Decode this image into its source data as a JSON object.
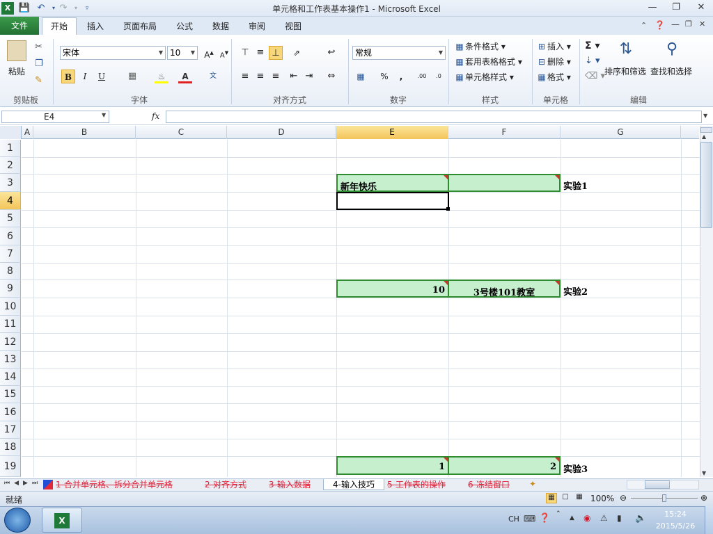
{
  "window": {
    "title": "单元格和工作表基本操作1 - Microsoft Excel"
  },
  "ribbon": {
    "tabs": [
      "文件",
      "开始",
      "插入",
      "页面布局",
      "公式",
      "数据",
      "审阅",
      "视图"
    ],
    "groups": {
      "clipboard": {
        "label": "剪贴板",
        "paste": "粘贴"
      },
      "font": {
        "label": "字体",
        "name": "宋体",
        "size": "10"
      },
      "alignment": {
        "label": "对齐方式"
      },
      "number": {
        "label": "数字",
        "format": "常规"
      },
      "styles": {
        "label": "样式",
        "conditional": "条件格式",
        "table": "套用表格格式",
        "cell_styles": "单元格样式"
      },
      "cells": {
        "label": "单元格",
        "insert": "插入",
        "delete": "删除",
        "format": "格式"
      },
      "editing": {
        "label": "编辑",
        "sort": "排序和筛选",
        "find": "查找和选择"
      }
    }
  },
  "formula_bar": {
    "name_box": "E4",
    "fx": "fx",
    "value": ""
  },
  "grid": {
    "columns": [
      "A",
      "B",
      "C",
      "D",
      "E",
      "F",
      "G"
    ],
    "selected_column": "E",
    "rows": [
      "1",
      "2",
      "3",
      "4",
      "5",
      "6",
      "7",
      "8",
      "9",
      "10",
      "11",
      "12",
      "13",
      "14",
      "15",
      "16",
      "17",
      "18",
      "19"
    ],
    "selected_row": "4",
    "cells": {
      "E3": "新年快乐",
      "G3": "实验1",
      "E9": "10",
      "F9": "3号楼101教室",
      "G9": "实验2",
      "E19": "1",
      "F19": "2",
      "G19": "实验3"
    }
  },
  "sheets": [
    "1-合并单元格、拆分合并单元格",
    "2-对齐方式",
    "3-输入数据",
    "4-输入技巧",
    "5-工作表的操作",
    "6-冻结窗口"
  ],
  "active_sheet": "4-输入技巧",
  "status": {
    "mode": "就绪",
    "zoom": "100%"
  },
  "taskbar": {
    "lang": "CH",
    "time": "15:24",
    "date": "2015/5/26"
  }
}
